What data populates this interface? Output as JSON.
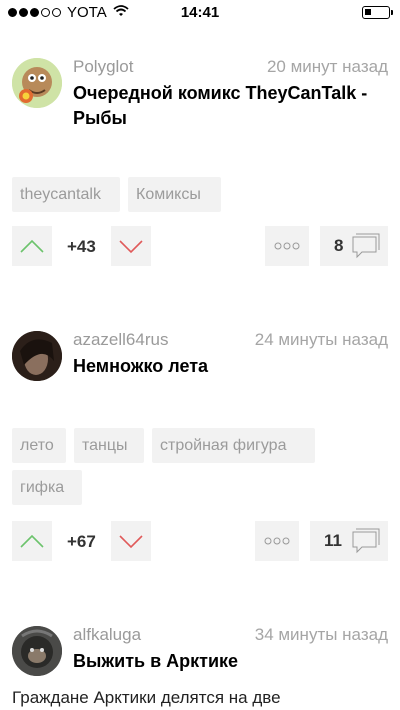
{
  "status_bar": {
    "carrier": "YOTA",
    "time": "14:41",
    "signal_bars": 3,
    "battery_level": 0.25
  },
  "posts": [
    {
      "author": "Polyglot",
      "time": "20 минут назад",
      "title": "Очередной комикс TheyCanTalk - Рыбы",
      "tags": [
        "theycantalk",
        "Комиксы"
      ],
      "rating": "+43",
      "comments": "8"
    },
    {
      "author": "azazell64rus",
      "time": "24 минуты назад",
      "title": "Немножко лета",
      "tags": [
        "лето",
        "танцы",
        "стройная фигура",
        "гифка"
      ],
      "rating": "+67",
      "comments": "11"
    },
    {
      "author": "alfkaluga",
      "time": "34 минуты назад",
      "title": "Выжить в Арктике",
      "preview": "Граждане Арктики делятся на две"
    }
  ],
  "colors": {
    "upvote": "#6cc36c",
    "downvote": "#e05a5a",
    "tag_bg": "#f2f2f2",
    "meta_text": "#9a9a9a"
  },
  "icons": [
    "wifi-icon",
    "battery-icon",
    "upvote-arrow-icon",
    "downvote-arrow-icon",
    "more-dots-icon",
    "comment-bubble-icon"
  ]
}
